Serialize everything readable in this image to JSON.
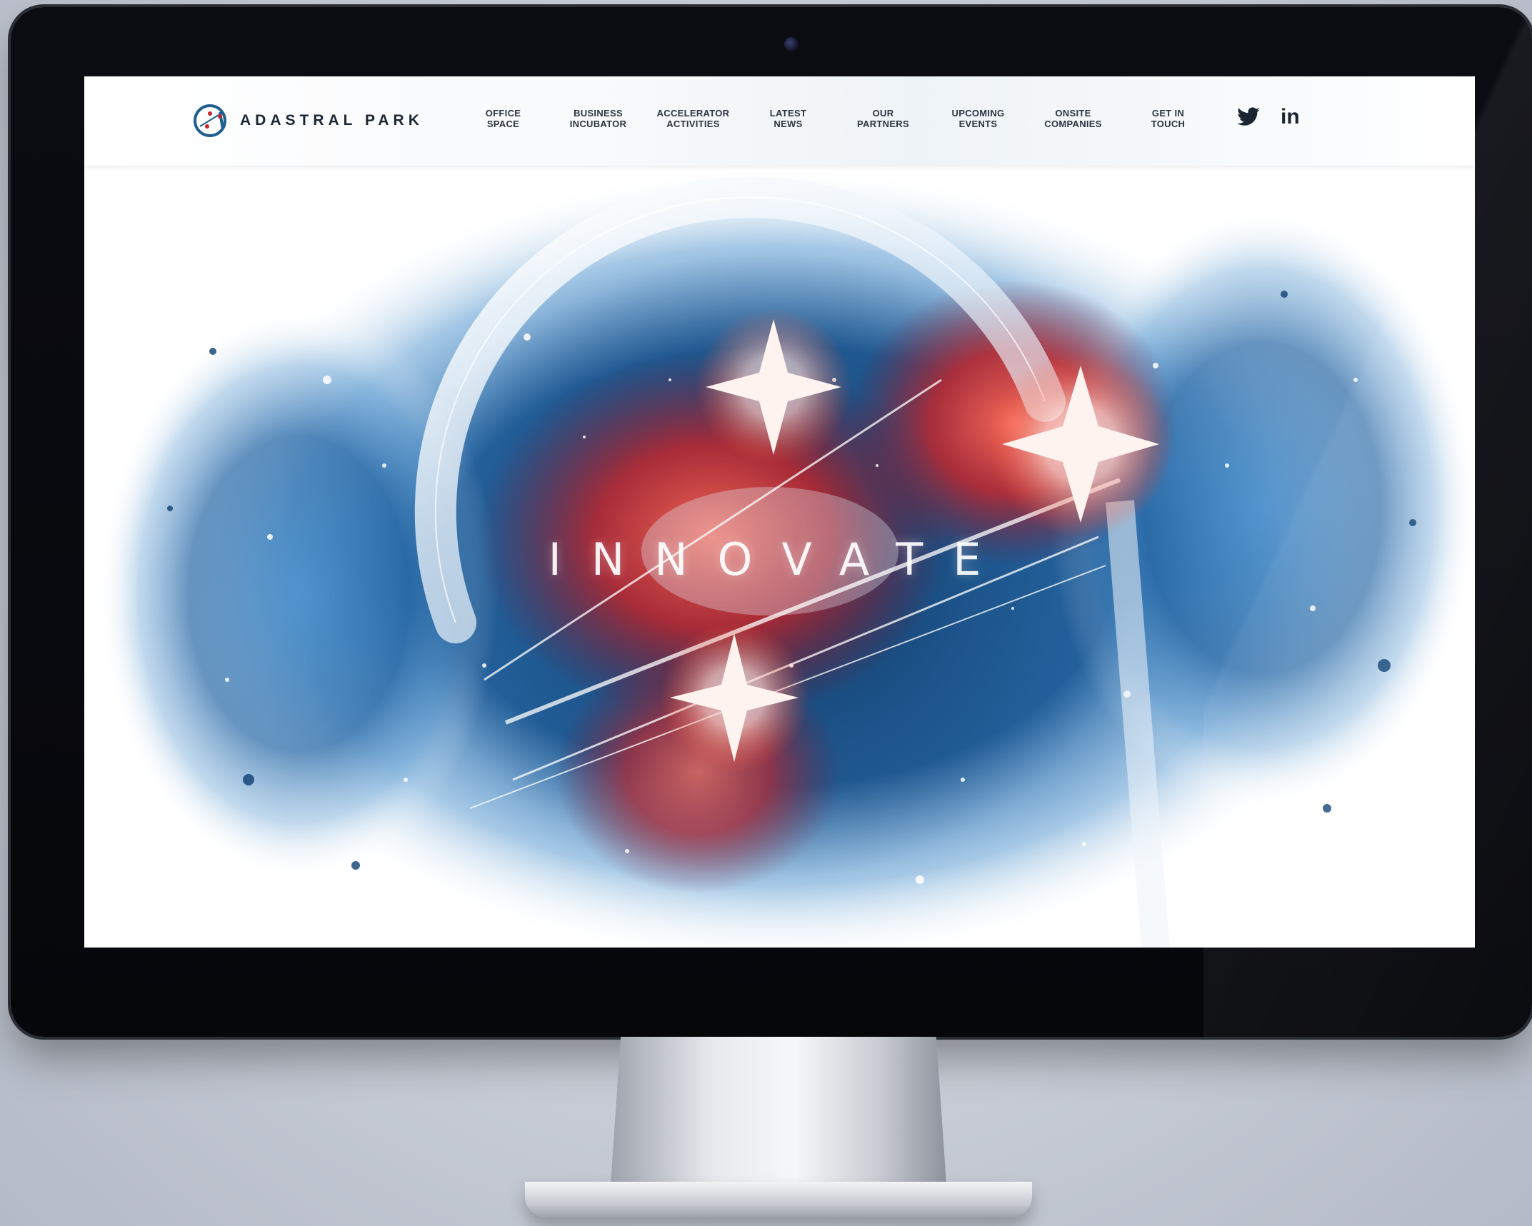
{
  "site": {
    "brand": "ADASTRAL PARK",
    "nav": [
      {
        "label": "OFFICE\nSPACE"
      },
      {
        "label": "BUSINESS\nINCUBATOR"
      },
      {
        "label": "ACCELERATOR\nACTIVITIES"
      },
      {
        "label": "LATEST\nNEWS"
      },
      {
        "label": "OUR\nPARTNERS"
      },
      {
        "label": "UPCOMING\nEVENTS"
      },
      {
        "label": "ONSITE\nCOMPANIES"
      },
      {
        "label": "GET IN\nTOUCH"
      }
    ],
    "social": {
      "twitter_icon": "twitter-bird-icon",
      "linkedin_text": "in"
    },
    "hero": {
      "headline": "INNOVATE"
    }
  },
  "colors": {
    "nebula_blue": "#1b5fa0",
    "nebula_red": "#c0262c",
    "text_dark": "#1b2633"
  }
}
